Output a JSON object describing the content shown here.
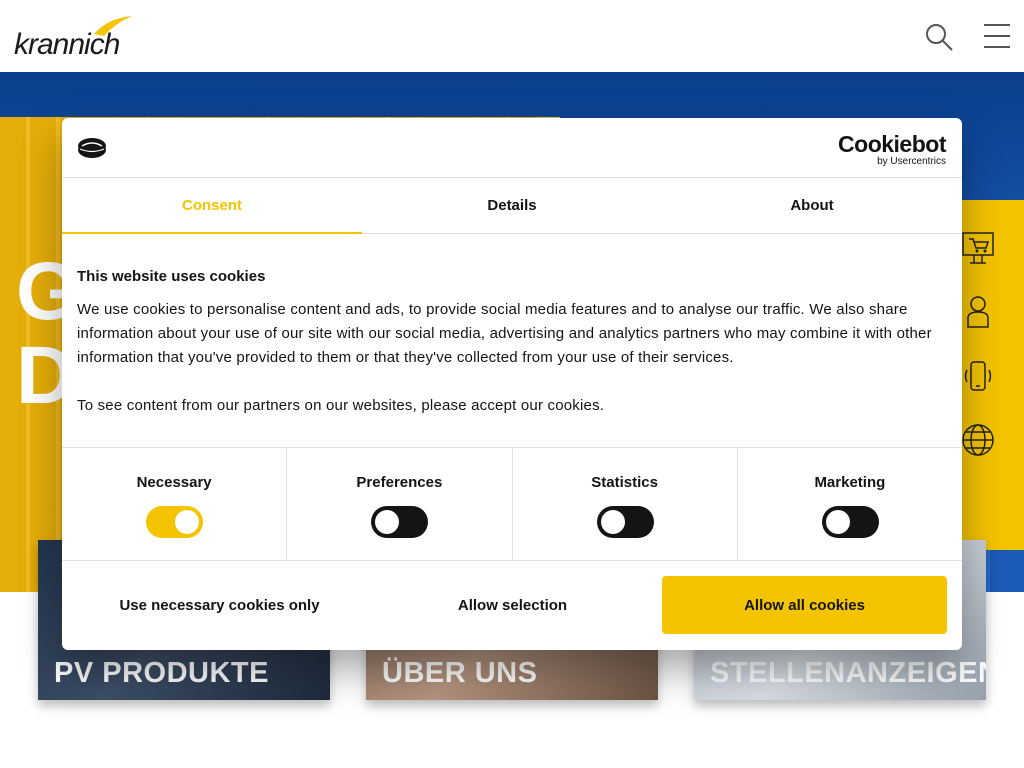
{
  "header": {
    "logo_text": "krannich"
  },
  "hero": {
    "headline_line1": "G",
    "headline_line2": "D"
  },
  "cards": [
    {
      "label": "PV PRODUKTE"
    },
    {
      "label": "ÜBER UNS"
    },
    {
      "label": "STELLENANZEIGEN"
    }
  ],
  "dialog": {
    "brand_name": "Cookiebot",
    "brand_by": "by Usercentrics",
    "tabs": [
      {
        "label": "Consent",
        "active": true
      },
      {
        "label": "Details",
        "active": false
      },
      {
        "label": "About",
        "active": false
      }
    ],
    "title": "This website uses cookies",
    "paragraph1": "We use cookies to personalise content and ads, to provide social media features and to analyse our traffic. We also share information about your use of our site with our social media, advertising and analytics partners who may combine it with other information that you've provided to them or that they've collected from your use of their services.",
    "paragraph2": "To see content from our partners on our websites, please accept our cookies.",
    "categories": [
      {
        "name": "Necessary",
        "enabled": true
      },
      {
        "name": "Preferences",
        "enabled": false
      },
      {
        "name": "Statistics",
        "enabled": false
      },
      {
        "name": "Marketing",
        "enabled": false
      }
    ],
    "buttons": {
      "necessary_only": "Use necessary cookies only",
      "allow_selection": "Allow selection",
      "allow_all": "Allow all cookies"
    }
  },
  "colors": {
    "accent": "#f4c400",
    "hero_blue": "#1a5bb8",
    "text": "#141414"
  }
}
